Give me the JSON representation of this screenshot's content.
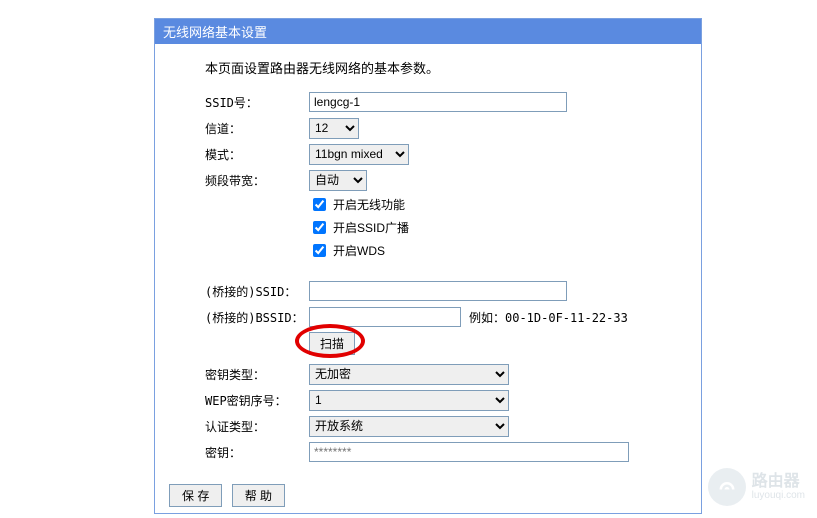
{
  "header": {
    "title": "无线网络基本设置"
  },
  "desc": "本页面设置路由器无线网络的基本参数。",
  "labels": {
    "ssid": "SSID号：",
    "channel": "信道：",
    "mode": "模式：",
    "bandwidth": "频段带宽：",
    "bridge_ssid": "(桥接的)SSID：",
    "bridge_bssid": "(桥接的)BSSID：",
    "keytype": "密钥类型：",
    "wepidx": "WEP密钥序号：",
    "auth": "认证类型：",
    "key": "密钥："
  },
  "values": {
    "ssid": "lengcg-1",
    "channel": "12",
    "mode": "11bgn mixed",
    "bandwidth": "自动",
    "bridge_ssid": "",
    "bridge_bssid": "",
    "keytype": "无加密",
    "wepidx": "1",
    "auth": "开放系统",
    "key_placeholder": "********"
  },
  "checkboxes": {
    "enable_wifi": {
      "label": "开启无线功能",
      "checked": true
    },
    "enable_ssid": {
      "label": "开启SSID广播",
      "checked": true
    },
    "enable_wds": {
      "label": "开启WDS",
      "checked": true
    }
  },
  "example": "例如：00-1D-0F-11-22-33",
  "buttons": {
    "scan": "扫描",
    "save": "保 存",
    "help": "帮 助"
  },
  "watermark": {
    "title": "路由器",
    "sub": "luyouqi.com"
  }
}
